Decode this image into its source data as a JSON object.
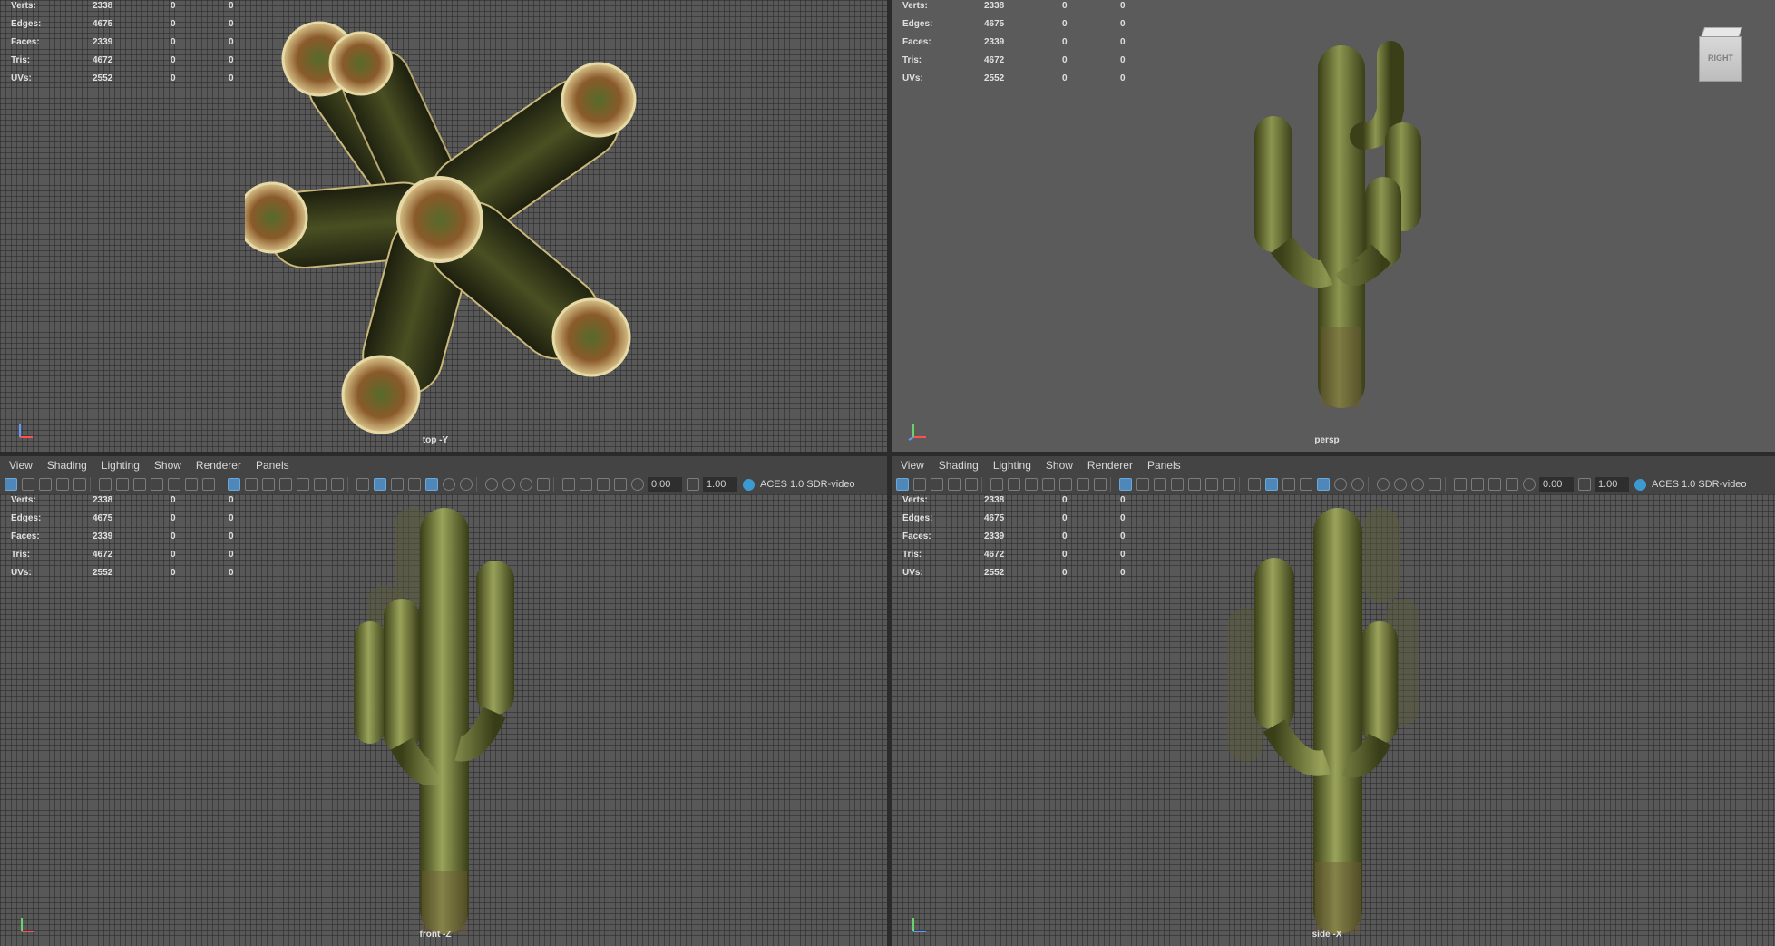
{
  "hud_stats": {
    "rows": [
      {
        "label": "Verts:",
        "values": [
          "2338",
          "0",
          "0"
        ]
      },
      {
        "label": "Edges:",
        "values": [
          "4675",
          "0",
          "0"
        ]
      },
      {
        "label": "Faces:",
        "values": [
          "2339",
          "0",
          "0"
        ]
      },
      {
        "label": "Tris:",
        "values": [
          "4672",
          "0",
          "0"
        ]
      },
      {
        "label": "UVs:",
        "values": [
          "2552",
          "0",
          "0"
        ]
      }
    ]
  },
  "viewports": {
    "top": {
      "camera": "top -Y"
    },
    "persp": {
      "camera": "persp"
    },
    "front": {
      "camera": "front -Z"
    },
    "side": {
      "camera": "side -X"
    }
  },
  "viewcube": {
    "face_label": "RIGHT"
  },
  "panel_menu": {
    "items": [
      "View",
      "Shading",
      "Lighting",
      "Show",
      "Renderer",
      "Panels"
    ]
  },
  "toolbar": {
    "exposure_value": "0.00",
    "gamma_value": "1.00",
    "color_space": "ACES 1.0 SDR-video"
  },
  "colors": {
    "cactus_body": "#6f7a3c",
    "cactus_dark": "#2d3014",
    "cactus_tip": "#b9873b",
    "accent_blue": "#4f88b8"
  }
}
